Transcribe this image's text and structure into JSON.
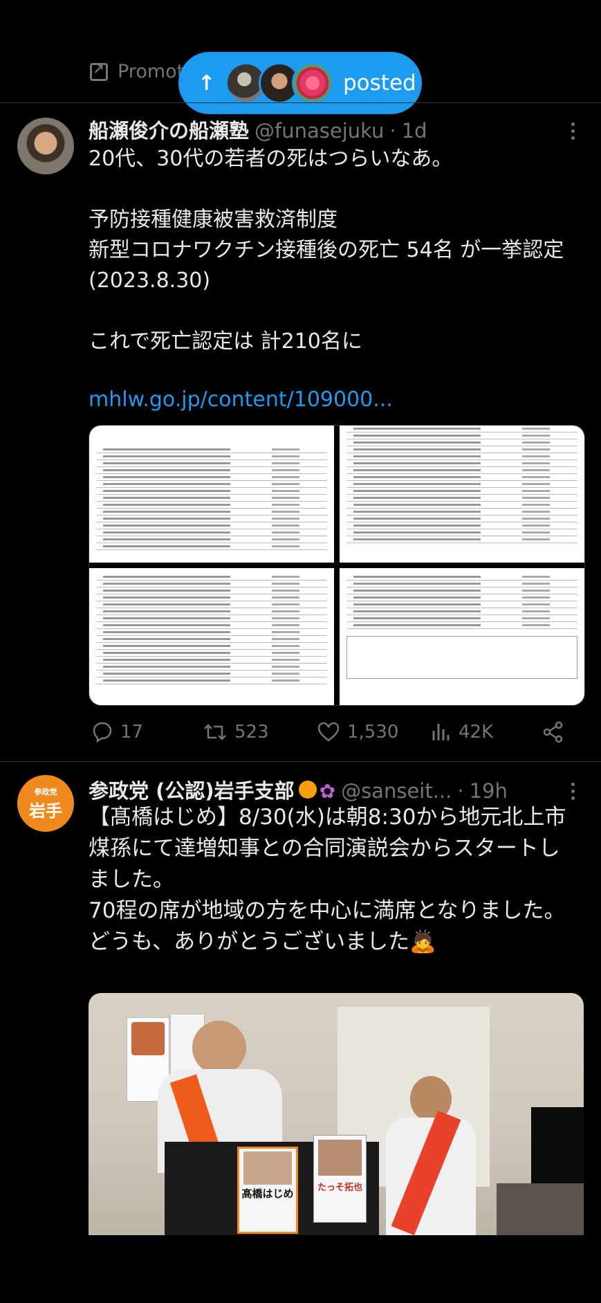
{
  "top_bar": {
    "promoted_label": "Promot",
    "posted_pill": {
      "label": "posted",
      "avatar_count": 3
    }
  },
  "tweets": [
    {
      "author_name": "船瀬俊介の船瀬塾",
      "handle": "@funasejuku",
      "separator": "·",
      "time": "1d",
      "text": "20代、30代の若者の死はつらいなあ。\n\n予防接種健康被害救済制度\n新型コロナワクチン接種後の死亡 54名 が一挙認定(2023.8.30)\n\nこれで死亡認定は 計210名に",
      "link": "mhlw.go.jp/content/109000...",
      "stats": {
        "replies": "17",
        "reposts": "523",
        "likes": "1,530",
        "views": "42K"
      }
    },
    {
      "author_name": "参政党 (公認)岩手支部",
      "name_emojis": [
        "orange-circle",
        "flower"
      ],
      "handle": "@sanseit...",
      "separator": "·",
      "time": "19h",
      "avatar_text": {
        "small": "参政党",
        "large": "岩手"
      },
      "text": "【髙橋はじめ】8/30(水)は朝8:30から地元北上市煤孫にて達増知事との合同演説会からスタートしました。\n70程の席が地域の方を中心に満席となりました。\nどうも、ありがとうございました🙇",
      "photo_poster_text": [
        "髙橋はじめ",
        "たっそ拓也"
      ]
    }
  ],
  "colors": {
    "accent": "#1d9bf0",
    "muted": "#71767b",
    "text": "#e7e9ea",
    "background": "#000000"
  }
}
